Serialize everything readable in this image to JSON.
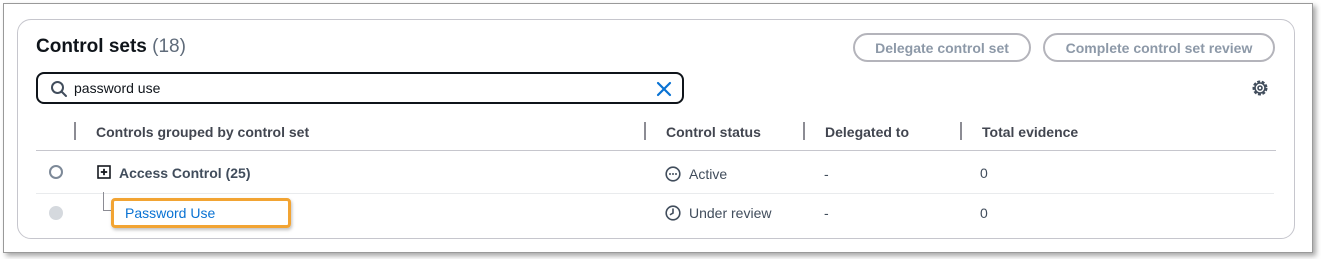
{
  "panel": {
    "title": "Control sets",
    "count": "(18)",
    "buttons": {
      "delegate": "Delegate control set",
      "complete": "Complete control set review"
    }
  },
  "search": {
    "value": "password use",
    "placeholder": ""
  },
  "icons": {
    "search": "search-icon",
    "clear": "close-icon",
    "settings": "gear-icon",
    "expand": "expand-plus-icon",
    "active": "ellipsis-circle-icon",
    "under_review": "clock-icon"
  },
  "table": {
    "columns": [
      "Controls grouped by control set",
      "Control status",
      "Delegated to",
      "Total evidence"
    ],
    "rows": [
      {
        "name": "Access Control (25)",
        "status": "Active",
        "delegated_to": "-",
        "total_evidence": "0"
      },
      {
        "name": "Password Use",
        "status": "Under review",
        "delegated_to": "-",
        "total_evidence": "0"
      }
    ]
  },
  "colors": {
    "link": "#0972d3",
    "highlight": "#f2a433",
    "clear_icon": "#0972d3",
    "disabled_button_text": "#8d99a8"
  }
}
